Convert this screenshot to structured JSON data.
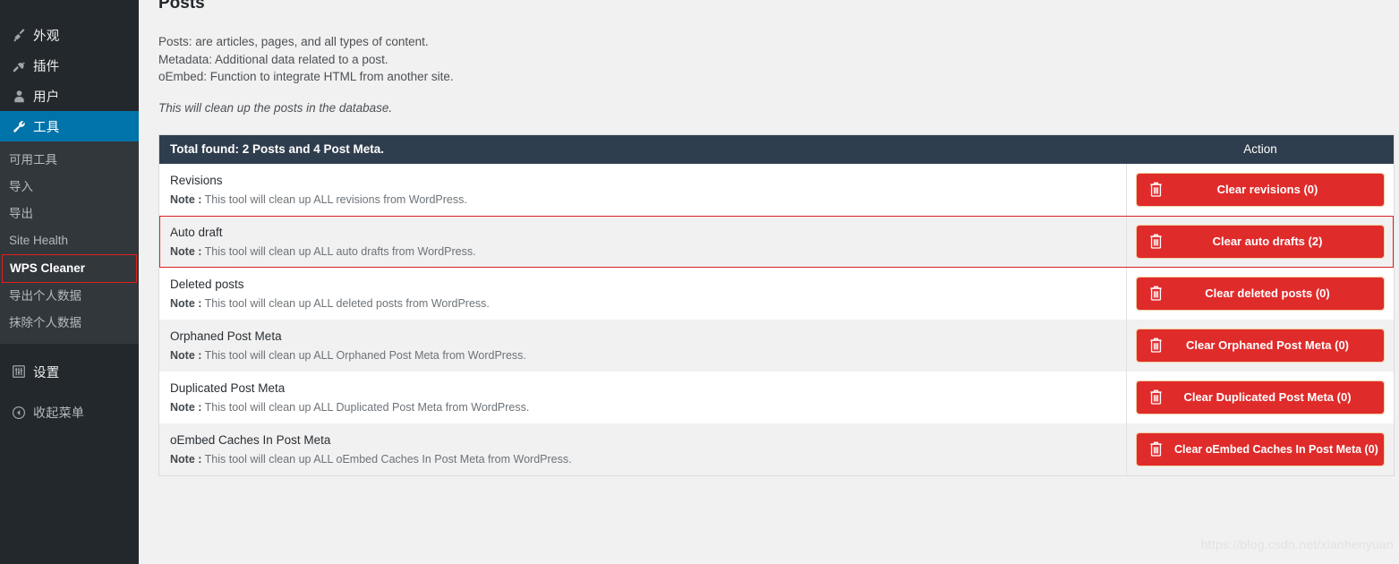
{
  "sidebar": {
    "top_items": [
      {
        "label": "外观",
        "icon": "paintbrush-icon",
        "name": "appearance"
      },
      {
        "label": "插件",
        "icon": "plug-icon",
        "name": "plugins"
      },
      {
        "label": "用户",
        "icon": "user-icon",
        "name": "users"
      },
      {
        "label": "工具",
        "icon": "wrench-icon",
        "name": "tools",
        "active": true
      }
    ],
    "submenu": [
      {
        "label": "可用工具",
        "name": "available-tools"
      },
      {
        "label": "导入",
        "name": "import"
      },
      {
        "label": "导出",
        "name": "export"
      },
      {
        "label": "Site Health",
        "name": "site-health"
      },
      {
        "label": "WPS Cleaner",
        "name": "wps-cleaner",
        "current": true,
        "annotated": true
      },
      {
        "label": "导出个人数据",
        "name": "export-personal-data"
      },
      {
        "label": "抹除个人数据",
        "name": "erase-personal-data"
      }
    ],
    "bottom_items": [
      {
        "label": "设置",
        "icon": "sliders-icon",
        "name": "settings"
      }
    ],
    "collapse": {
      "label": "收起菜单",
      "icon": "collapse-left-icon",
      "name": "collapse-menu"
    }
  },
  "main": {
    "title": "Posts",
    "description_lines": [
      "Posts: are articles, pages, and all types of content.",
      "Metadata: Additional data related to a post.",
      "oEmbed: Function to integrate HTML from another site."
    ],
    "note": "This will clean up the posts in the database.",
    "panel": {
      "total_found": "Total found: 2 Posts and 4 Post Meta.",
      "action_column_header": "Action",
      "note_prefix": "Note :",
      "rows": [
        {
          "title": "Revisions",
          "note": "This tool will clean up ALL revisions from WordPress.",
          "button": "Clear revisions (0)",
          "count": 0,
          "striped": false,
          "highlighted": false
        },
        {
          "title": "Auto draft",
          "note": "This tool will clean up ALL auto drafts from WordPress.",
          "button": "Clear auto drafts (2)",
          "count": 2,
          "striped": true,
          "highlighted": true
        },
        {
          "title": "Deleted posts",
          "note": "This tool will clean up ALL deleted posts from WordPress.",
          "button": "Clear deleted posts (0)",
          "count": 0,
          "striped": false,
          "highlighted": false
        },
        {
          "title": "Orphaned Post Meta",
          "note": "This tool will clean up ALL Orphaned Post Meta from WordPress.",
          "button": "Clear Orphaned Post Meta (0)",
          "count": 0,
          "striped": true,
          "highlighted": false
        },
        {
          "title": "Duplicated Post Meta",
          "note": "This tool will clean up ALL Duplicated Post Meta from WordPress.",
          "button": "Clear Duplicated Post Meta (0)",
          "count": 0,
          "striped": false,
          "highlighted": false
        },
        {
          "title": "oEmbed Caches In Post Meta",
          "note": "This tool will clean up ALL oEmbed Caches In Post Meta from WordPress.",
          "button": "Clear oEmbed Caches In Post Meta (0)",
          "count": 0,
          "striped": true,
          "highlighted": false
        }
      ]
    }
  },
  "watermark": "https://blog.csdn.net/xianhenyuan",
  "colors": {
    "sidebar_bg": "#23282d",
    "submenu_bg": "#32373c",
    "active_blue": "#0073aa",
    "panel_header": "#2f3e4e",
    "danger_red": "#e02b2b",
    "annotation_red": "#e02020",
    "page_bg": "#f1f1f1"
  }
}
